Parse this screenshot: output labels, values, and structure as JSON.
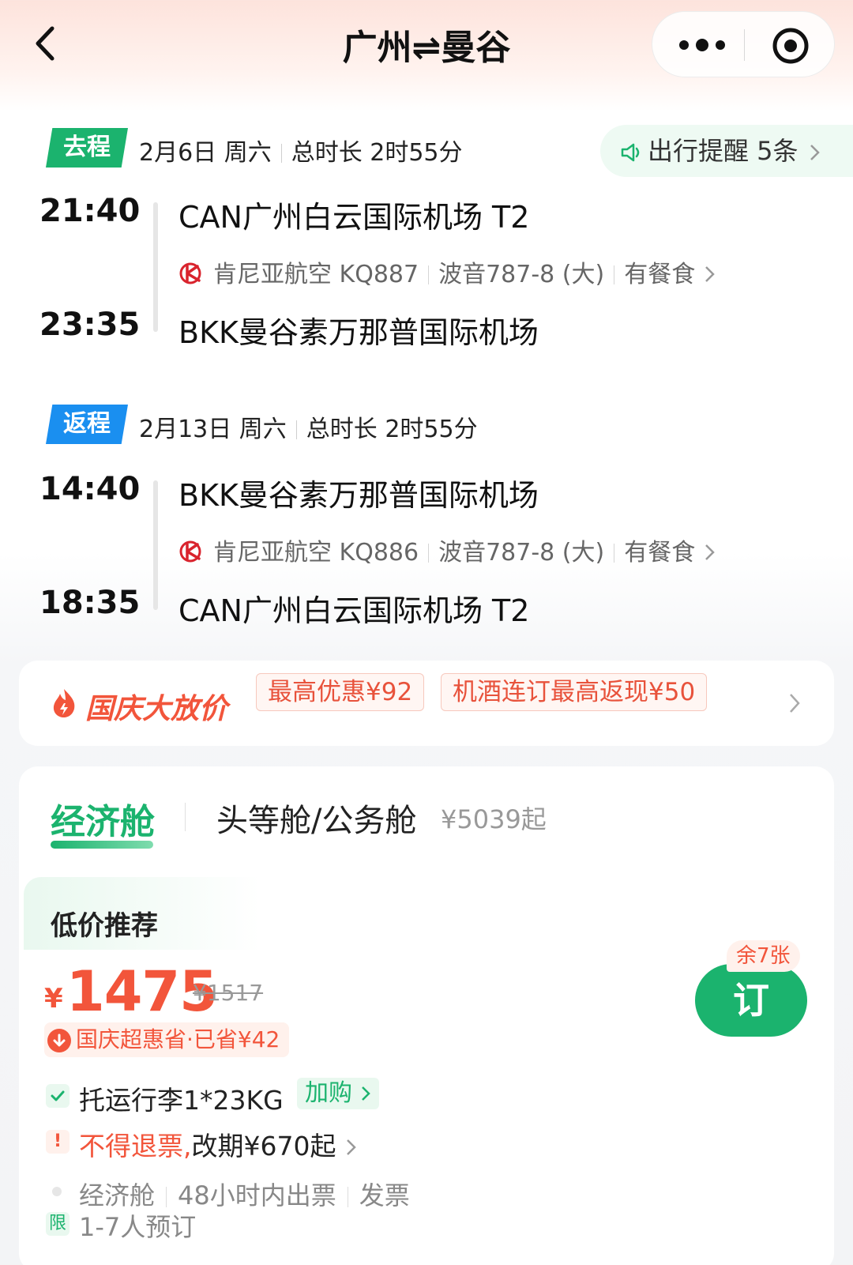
{
  "header": {
    "title": "广州⇌曼谷"
  },
  "outbound": {
    "tag": "去程",
    "date": "2月6日 周六",
    "duration": "总时长 2时55分",
    "reminder": "出行提醒 5条",
    "depart_time": "21:40",
    "depart_airport": "CAN广州白云国际机场 T2",
    "airline": "肯尼亚航空 KQ887",
    "aircraft": "波音787-8 (大)",
    "meal": "有餐食",
    "arrive_time": "23:35",
    "arrive_airport": "BKK曼谷素万那普国际机场"
  },
  "return": {
    "tag": "返程",
    "date": "2月13日 周六",
    "duration": "总时长 2时55分",
    "depart_time": "14:40",
    "depart_airport": "BKK曼谷素万那普国际机场",
    "airline": "肯尼亚航空 KQ886",
    "aircraft": "波音787-8 (大)",
    "meal": "有餐食",
    "arrive_time": "18:35",
    "arrive_airport": "CAN广州白云国际机场 T2"
  },
  "promo": {
    "title": "国庆大放价",
    "chip1": "最高优惠¥92",
    "chip2": "机酒连订最高返现¥50"
  },
  "fare": {
    "tab_economy": "经济舱",
    "tab_first": "头等舱/公务舱",
    "tab_first_price": "¥5039起",
    "recommend_title": "低价推荐",
    "currency": "¥",
    "price": "1475",
    "original_price": "¥1517",
    "saving": "国庆超惠省·已省¥42",
    "remaining": "余7张",
    "book_label": "订",
    "baggage": "托运行李1*23KG",
    "baggage_buy": "加购",
    "refund_prefix": "不得退票,",
    "refund_suffix": "改期¥670起",
    "meta_class": "经济舱",
    "meta_ticket": "48小时内出票",
    "meta_invoice": "发票",
    "limit_badge": "限",
    "limit_text": "1-7人预订"
  },
  "colors": {
    "green": "#1bb36e",
    "blue": "#1a8ff0",
    "orange": "#f2553b"
  }
}
